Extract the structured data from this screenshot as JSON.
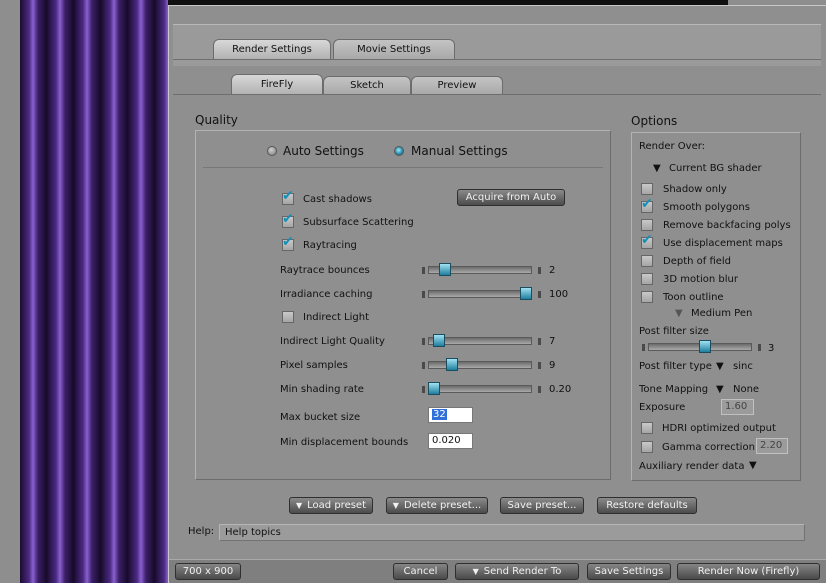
{
  "tabs_top": [
    {
      "label": "Render Settings",
      "active": true
    },
    {
      "label": "Movie Settings",
      "active": false
    }
  ],
  "tabs_sub": [
    {
      "label": "FireFly",
      "active": true
    },
    {
      "label": "Sketch",
      "active": false
    },
    {
      "label": "Preview",
      "active": false
    }
  ],
  "quality": {
    "title": "Quality",
    "mode_auto": "Auto Settings",
    "mode_manual": "Manual Settings",
    "selected_mode": "Manual Settings",
    "cast_shadows": {
      "label": "Cast shadows",
      "checked": true
    },
    "subsurface": {
      "label": "Subsurface Scattering",
      "checked": true
    },
    "raytracing": {
      "label": "Raytracing",
      "checked": true
    },
    "acquire_button": "Acquire from Auto",
    "raytrace_bounces": {
      "label": "Raytrace bounces",
      "value": "2",
      "fraction": 0.12
    },
    "irradiance_caching": {
      "label": "Irradiance caching",
      "value": "100",
      "fraction": 1.0
    },
    "indirect_light": {
      "label": "Indirect Light",
      "checked": false
    },
    "indirect_light_quality": {
      "label": "Indirect Light Quality",
      "value": "7",
      "fraction": 0.05
    },
    "pixel_samples": {
      "label": "Pixel samples",
      "value": "9",
      "fraction": 0.2
    },
    "min_shading_rate": {
      "label": "Min shading rate",
      "value": "0.20",
      "fraction": 0.0
    },
    "max_bucket_size": {
      "label": "Max bucket size",
      "value": "32"
    },
    "min_displacement_bounds": {
      "label": "Min displacement bounds",
      "value": "0.020"
    }
  },
  "options": {
    "title": "Options",
    "render_over_label": "Render Over:",
    "render_over_value": "Current BG shader",
    "shadow_only": {
      "label": "Shadow only",
      "checked": false
    },
    "smooth_polygons": {
      "label": "Smooth polygons",
      "checked": true
    },
    "remove_backfacing": {
      "label": "Remove backfacing polys",
      "checked": false
    },
    "use_displacement": {
      "label": "Use displacement maps",
      "checked": true
    },
    "depth_of_field": {
      "label": "Depth of field",
      "checked": false
    },
    "motion_blur": {
      "label": "3D motion blur",
      "checked": false
    },
    "toon_outline": {
      "label": "Toon outline",
      "checked": false
    },
    "toon_pen": "Medium Pen",
    "post_filter_size": {
      "label": "Post filter size",
      "value": "3",
      "fraction": 0.55
    },
    "post_filter_type_label": "Post filter type",
    "post_filter_type_value": "sinc",
    "tone_mapping_label": "Tone Mapping",
    "tone_mapping_value": "None",
    "exposure_label": "Exposure",
    "exposure_value": "1.60",
    "hdri": {
      "label": "HDRI optimized output",
      "checked": false
    },
    "gamma": {
      "label": "Gamma correction",
      "checked": false
    },
    "gamma_value": "2.20",
    "aux_label": "Auxiliary render data"
  },
  "presets": {
    "load": "Load preset",
    "delete": "Delete preset...",
    "save": "Save preset...",
    "restore": "Restore defaults"
  },
  "help": {
    "label": "Help:",
    "text": "Help topics"
  },
  "footer": {
    "size": "700 x 900",
    "cancel": "Cancel",
    "send": "Send Render To",
    "save_settings": "Save Settings",
    "render_now": "Render Now (Firefly)"
  },
  "colors": {
    "accent": "#1f8fb5",
    "panel": "#8f8f8f",
    "button": "#5a5a5a"
  }
}
